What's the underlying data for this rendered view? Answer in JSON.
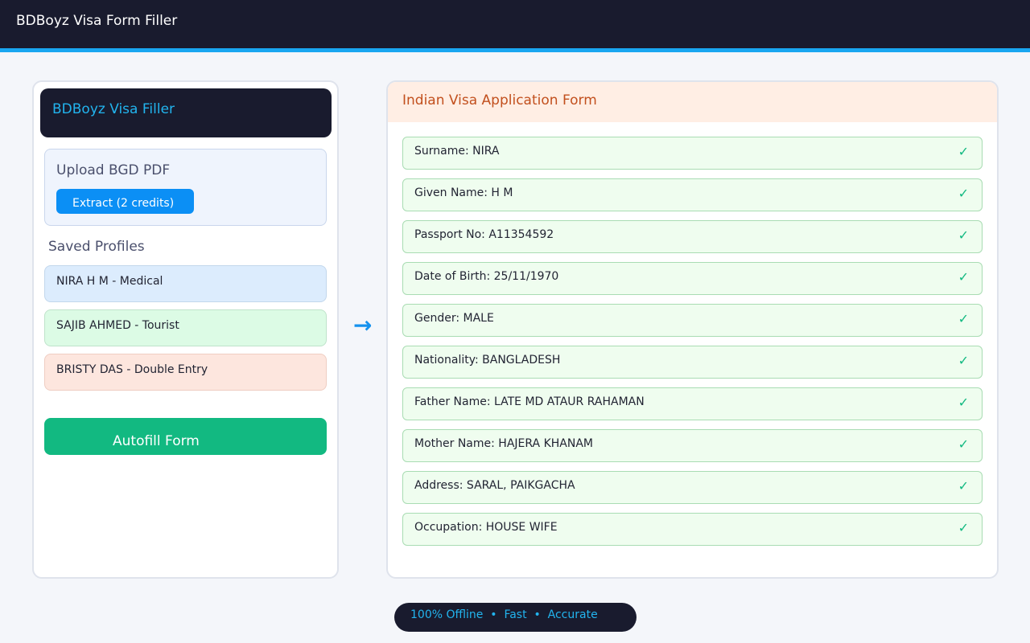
{
  "app": {
    "title": "BDBoyz Visa Form Filler"
  },
  "sidebar": {
    "brand": "BDBoyz Visa Filler",
    "upload": {
      "title": "Upload BGD PDF",
      "extract_label": "Extract (2 credits)"
    },
    "saved_title": "Saved Profiles",
    "profiles": [
      {
        "label": "NIRA H M - Medical"
      },
      {
        "label": "SAJIB AHMED - Tourist"
      },
      {
        "label": "BRISTY DAS - Double Entry"
      }
    ],
    "autofill_label": "Autofill Form"
  },
  "arrow": "→",
  "form": {
    "title": "Indian Visa Application Form",
    "check_glyph": "✓",
    "fields": [
      {
        "text": "Surname: NIRA"
      },
      {
        "text": "Given Name: H M"
      },
      {
        "text": "Passport No: A11354592"
      },
      {
        "text": "Date of Birth: 25/11/1970"
      },
      {
        "text": "Gender: MALE"
      },
      {
        "text": "Nationality: BANGLADESH"
      },
      {
        "text": "Father Name: LATE MD ATAUR RAHAMAN"
      },
      {
        "text": "Mother Name: HAJERA KHANAM"
      },
      {
        "text": "Address: SARAL, PAIKGACHA"
      },
      {
        "text": "Occupation: HOUSE WIFE"
      }
    ]
  },
  "footer": {
    "text": "100% Offline  •  Fast  •  Accurate"
  },
  "colors": {
    "topbar": "#191b2e",
    "accent": "#19a6f0",
    "success": "#12b981",
    "primary_button": "#0b8ff5",
    "form_header_bg": "#ffeee4",
    "form_header_text": "#c2501e"
  }
}
